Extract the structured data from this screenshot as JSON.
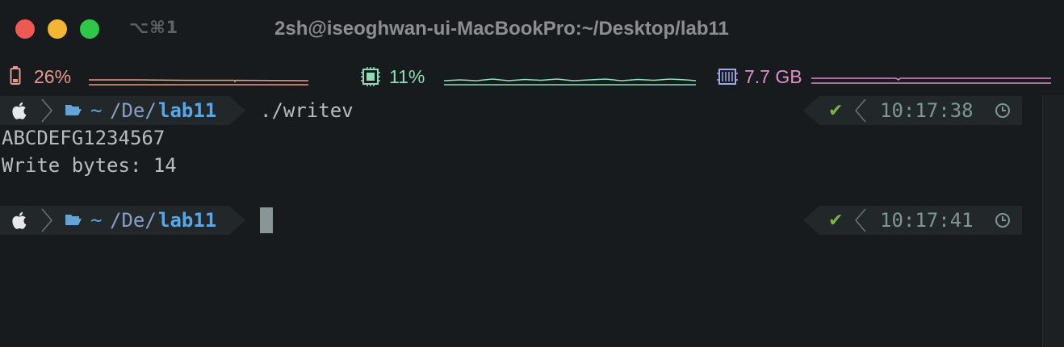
{
  "window": {
    "shortcut": "⌥⌘1",
    "title": "2sh@iseoghwan-ui-MacBookPro:~/Desktop/lab11"
  },
  "status_bar": {
    "battery": {
      "icon": "battery-icon",
      "value": "26%",
      "color": "#e79a8c"
    },
    "cpu": {
      "icon": "cpu-chip-icon",
      "value": "11%",
      "color": "#8fdcb6"
    },
    "memory": {
      "icon": "memory-icon",
      "value": "7.7 GB",
      "color": "#de8fc7"
    }
  },
  "prompt1": {
    "path_tilde": "~",
    "path_mid": "/De/",
    "path_dir": "lab11",
    "command": "./writev",
    "status_icon": "✔",
    "time": "10:17:38"
  },
  "output": {
    "line1": "ABCDEFG1234567",
    "line2": "Write bytes: 14"
  },
  "prompt2": {
    "path_tilde": "~",
    "path_mid": "/De/",
    "path_dir": "lab11",
    "status_icon": "✔",
    "time": "10:17:41"
  },
  "colors": {
    "background": "#181b1d",
    "segment": "#22272a",
    "path_dir": "#56a8e8",
    "check": "#7fb545",
    "time": "#7f9596"
  }
}
